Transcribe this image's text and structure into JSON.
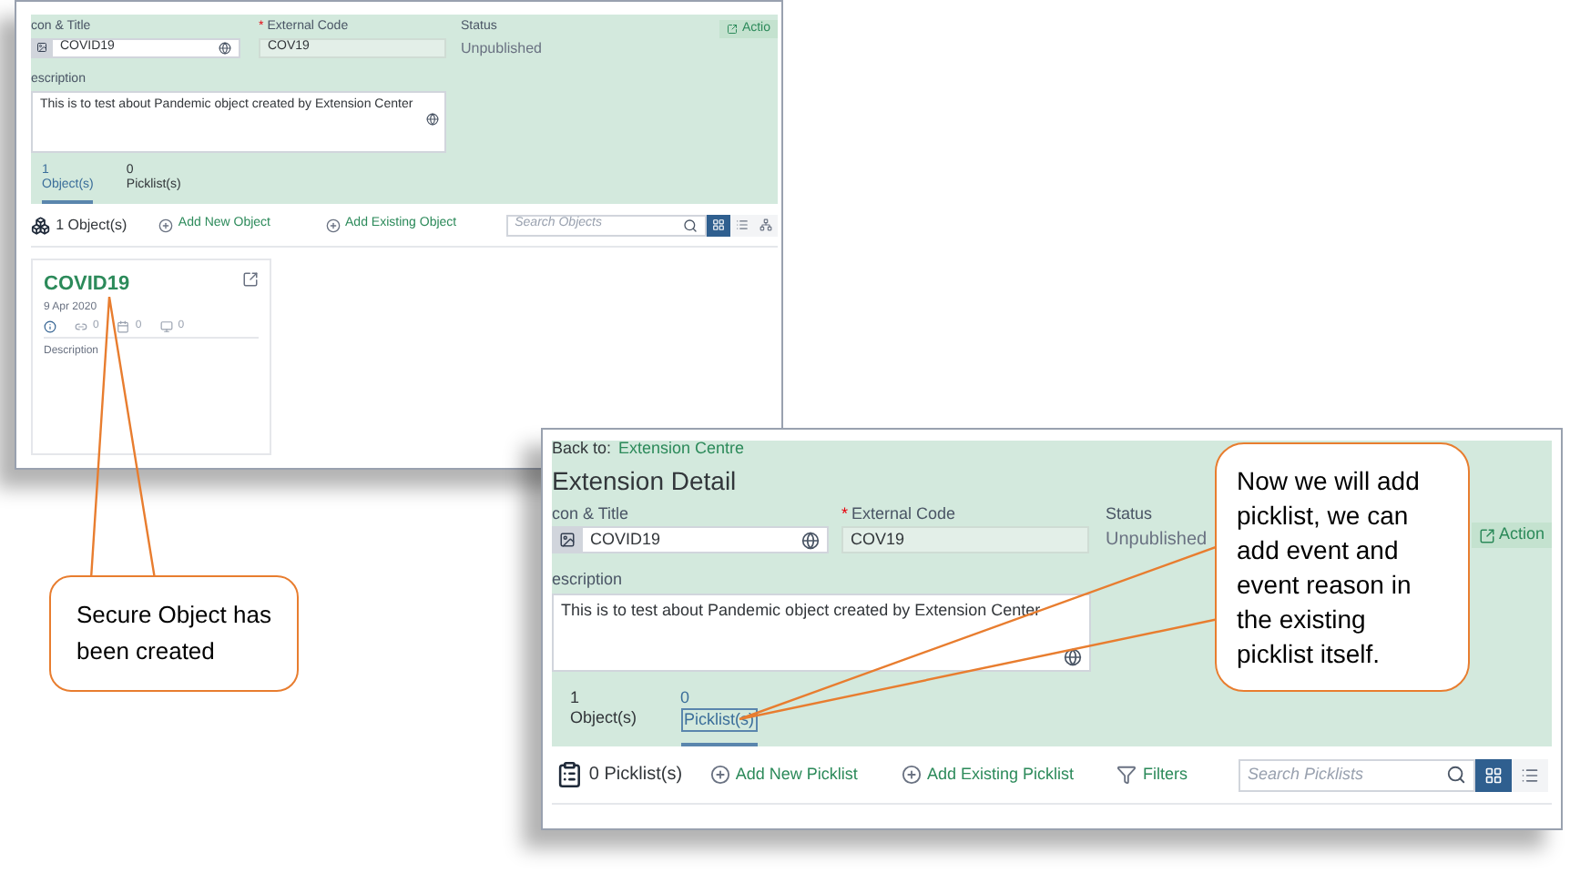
{
  "screens": [
    {
      "icon_title_label": "con & Title",
      "title_value": "COVID19",
      "required_mark": "*",
      "external_code_label": "External Code",
      "external_code_value": "COV19",
      "status_label": "Status",
      "status_value": "Unpublished",
      "action_label": "Actio",
      "description_label": "escription",
      "description_value": "This is to test about Pandemic object created by Extension Center",
      "tabs": [
        {
          "count": "1",
          "label": "Object(s)",
          "selected": true
        },
        {
          "count": "0",
          "label": "Picklist(s)",
          "selected": false
        }
      ],
      "toolbar": {
        "kind": "objects",
        "count_label": "1 Object(s)",
        "actions": [
          {
            "kind": "add",
            "label": "Add New Object"
          },
          {
            "kind": "add",
            "label": "Add Existing Object"
          }
        ],
        "search_placeholder": "Search Objects",
        "views": [
          {
            "kind": "grid",
            "selected": true
          },
          {
            "kind": "list",
            "selected": false
          },
          {
            "kind": "tree",
            "selected": false
          }
        ]
      },
      "card": {
        "title": "COVID19",
        "date": "9 Apr 2020",
        "stats": [
          "0",
          "0",
          "0"
        ],
        "description_label": "Description"
      }
    },
    {
      "back_label": "Back to:",
      "back_link": "Extension Centre",
      "heading": "Extension Detail",
      "icon_title_label": "con & Title",
      "title_value": "COVID19",
      "required_mark": "*",
      "external_code_label": "External Code",
      "external_code_value": "COV19",
      "status_label": "Status",
      "status_value": "Unpublished",
      "action_label": "Action",
      "description_label": "escription",
      "description_value": "This is to test about Pandemic object created by Extension Center",
      "tabs": [
        {
          "count": "1",
          "label": "Object(s)",
          "selected": false
        },
        {
          "count": "0",
          "label": "Picklist(s)",
          "selected": true
        }
      ],
      "toolbar": {
        "kind": "picklists",
        "count_label": "0 Picklist(s)",
        "actions": [
          {
            "kind": "add",
            "label": "Add New Picklist"
          },
          {
            "kind": "add",
            "label": "Add Existing Picklist"
          },
          {
            "kind": "filter",
            "label": "Filters"
          }
        ],
        "search_placeholder": "Search Picklists",
        "views": [
          {
            "kind": "grid",
            "selected": true
          },
          {
            "kind": "list",
            "selected": false
          }
        ]
      }
    }
  ],
  "callouts": [
    {
      "text": "Secure Object has been created"
    },
    {
      "text": "Now we will add picklist, we can add event and event reason in the existing picklist itself."
    }
  ]
}
